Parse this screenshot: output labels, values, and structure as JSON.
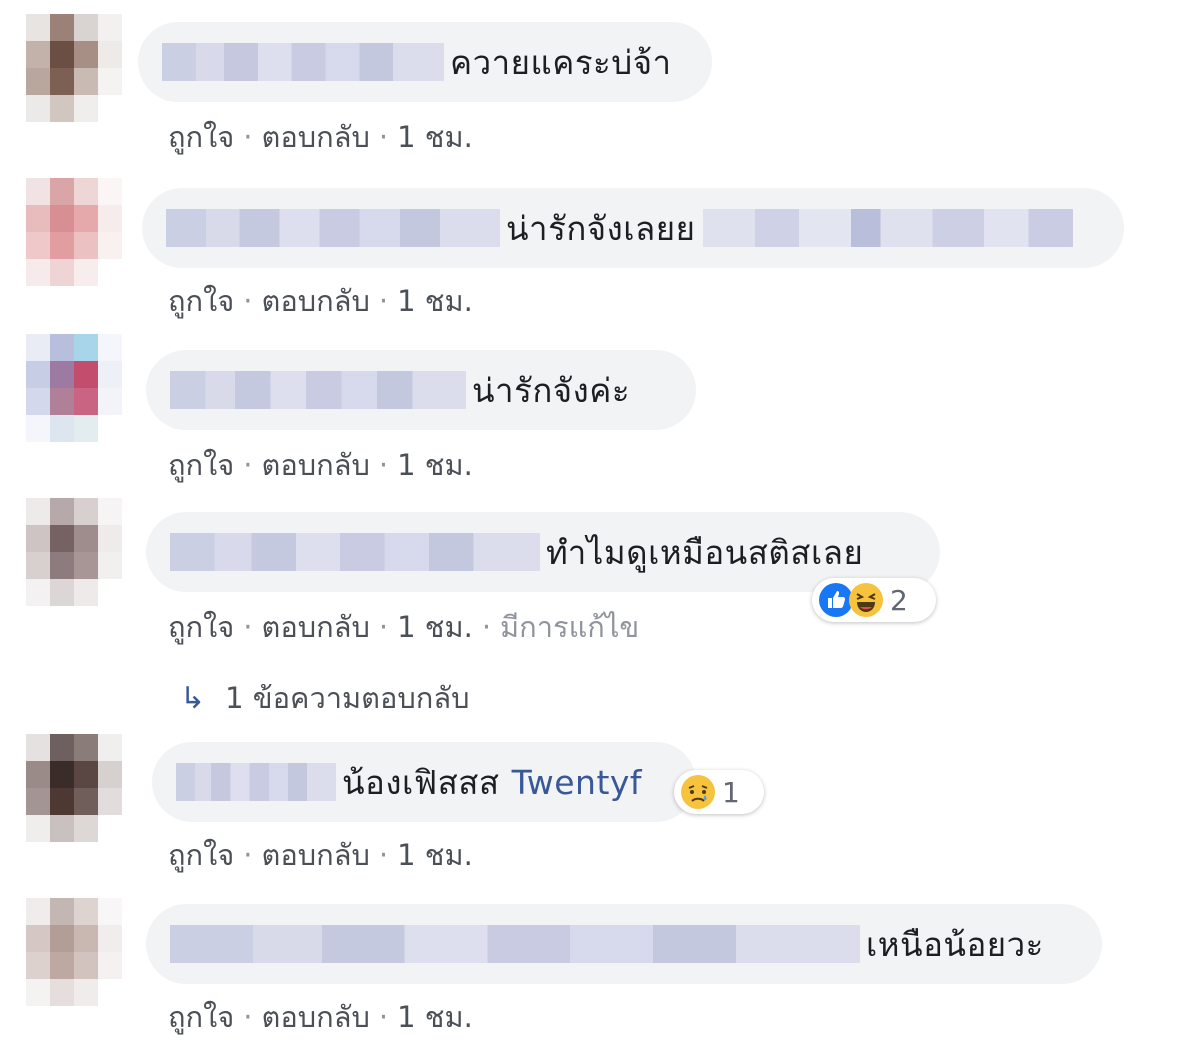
{
  "comments": [
    {
      "text": "ควายแคระบ่จ้า",
      "like": "ถูกใจ",
      "reply": "ตอบกลับ",
      "time": "1 ชม."
    },
    {
      "text": "น่ารักจังเลยย",
      "like": "ถูกใจ",
      "reply": "ตอบกลับ",
      "time": "1 ชม."
    },
    {
      "text": "น่ารักจังค่ะ",
      "like": "ถูกใจ",
      "reply": "ตอบกลับ",
      "time": "1 ชม."
    },
    {
      "text": "ทำไมดูเหมือนสติสเลย",
      "like": "ถูกใจ",
      "reply": "ตอบกลับ",
      "time": "1 ชม.",
      "edited": "มีการแก้ไข",
      "reactions": {
        "types": [
          "like-icon",
          "haha-icon"
        ],
        "count": "2"
      },
      "replies_link": "1 ข้อความตอบกลับ"
    },
    {
      "text": "น้องเฟิสสส",
      "mention": "Twentyf",
      "like": "ถูกใจ",
      "reply": "ตอบกลับ",
      "time": "1 ชม.",
      "reactions": {
        "types": [
          "sad-icon"
        ],
        "count": "1"
      }
    },
    {
      "text": "เหนือน้อยวะ",
      "like": "ถูกใจ",
      "reply": "ตอบกลับ",
      "time": "1 ชม."
    }
  ],
  "separator": "·",
  "colors": {
    "bubble": "#f2f3f5",
    "meta_text": "#4b4f56",
    "mention": "#385898",
    "like_blue": "#1877f2",
    "reaction_yellow": "#f7c33e"
  }
}
